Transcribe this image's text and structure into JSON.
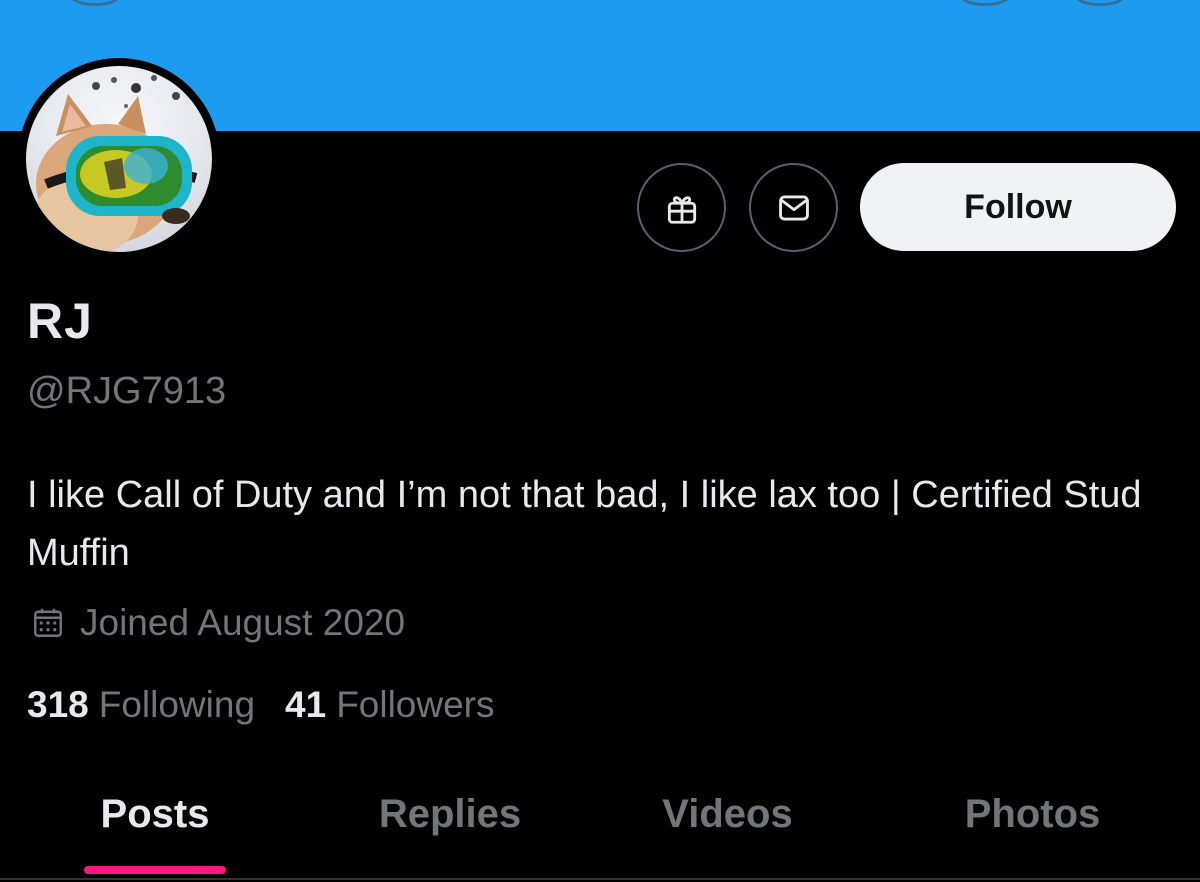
{
  "profile": {
    "display_name": "RJ",
    "handle": "@RJG7913",
    "bio": "I like Call of Duty and I’m not that bad, I like lax too | Certified Stud Muffin",
    "joined": "Joined August 2020",
    "following_count": "318",
    "following_label": "Following",
    "followers_count": "41",
    "followers_label": "Followers"
  },
  "actions": {
    "gift_icon": "gift-icon",
    "message_icon": "envelope-icon",
    "follow_label": "Follow"
  },
  "tabs": [
    {
      "label": "Posts",
      "active": true
    },
    {
      "label": "Replies",
      "active": false
    },
    {
      "label": "Videos",
      "active": false
    },
    {
      "label": "Photos",
      "active": false
    }
  ],
  "colors": {
    "banner": "#1d9bf0",
    "background": "#000000",
    "primary_text": "#e7e9ea",
    "secondary_text": "#71767b",
    "tab_indicator": "#f91880",
    "follow_button_bg": "#eff3f4"
  }
}
